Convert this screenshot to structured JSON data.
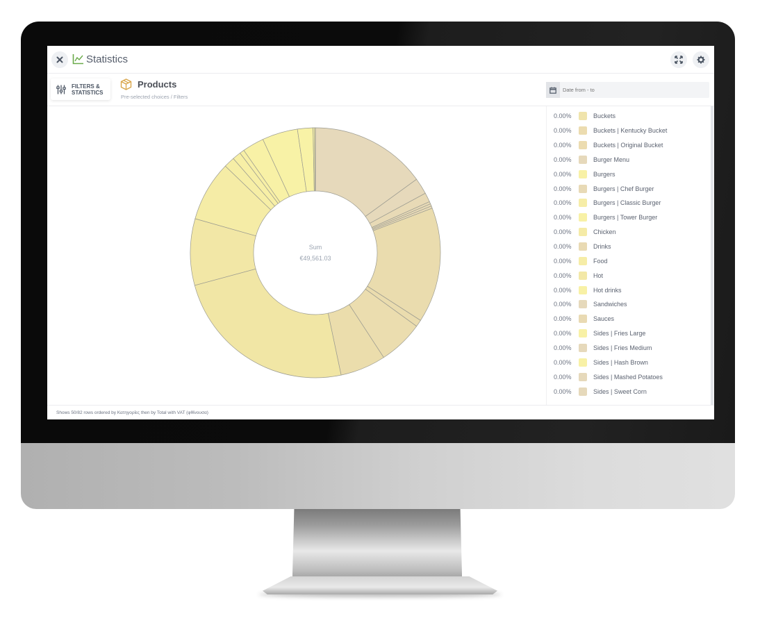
{
  "window": {
    "title": "Statistics",
    "close_icon": "close-icon",
    "title_icon": "line-chart-icon",
    "expand_icon": "expand-icon",
    "settings_icon": "gear-icon"
  },
  "toolbar": {
    "filters_label_line1": "FILTERS &",
    "filters_label_line2": "STATISTICS",
    "section_title": "Products",
    "section_subtitle": "Pre-selected choices / Filters",
    "date_placeholder": "Date from - to"
  },
  "footer": {
    "status_text": "Shows 50/82 rows ordered by Κατηγορίες then by Total with VAT (φθίνουσα)"
  },
  "colors": {
    "accent_green": "#6aaa4a",
    "box_gold": "#d9a54a",
    "slice_beige": "#e6d9bb",
    "slice_tan": "#ead9b0",
    "slice_khaki": "#ecdfad",
    "slice_yellow": "#f3e9a8",
    "slice_light_yellow": "#f8f1a6",
    "slice_border": "#9a9a90"
  },
  "chart_data": {
    "type": "pie",
    "variant": "donut",
    "title": "Products",
    "center_label": "Sum",
    "center_value": "€49,561.03",
    "total": 49561.03,
    "slices_percent_clockwise_from_top": [
      {
        "percent": 15.0,
        "color": "#e6d9bb"
      },
      {
        "percent": 2.1,
        "color": "#e6d9bb"
      },
      {
        "percent": 1.2,
        "color": "#e8dab6"
      },
      {
        "percent": 0.3,
        "color": "#e8dab6"
      },
      {
        "percent": 0.3,
        "color": "#e8dab6"
      },
      {
        "percent": 0.3,
        "color": "#e8dab6"
      },
      {
        "percent": 14.9,
        "color": "#eadcae"
      },
      {
        "percent": 0.9,
        "color": "#eadcae"
      },
      {
        "percent": 5.8,
        "color": "#ebddaf"
      },
      {
        "percent": 5.9,
        "color": "#ebddac"
      },
      {
        "percent": 24.1,
        "color": "#f1e6a5"
      },
      {
        "percent": 8.6,
        "color": "#f2e7a6"
      },
      {
        "percent": 7.8,
        "color": "#f5eca6"
      },
      {
        "percent": 1.4,
        "color": "#f6eea6"
      },
      {
        "percent": 1.1,
        "color": "#f7efa6"
      },
      {
        "percent": 0.6,
        "color": "#f7efa6"
      },
      {
        "percent": 2.8,
        "color": "#f8f1a6"
      },
      {
        "percent": 4.6,
        "color": "#f8f2a6"
      },
      {
        "percent": 2.0,
        "color": "#f8f2a6"
      },
      {
        "percent": 0.2,
        "color": "#f8f2a6"
      },
      {
        "percent": 0.1,
        "color": "#f8f2a6"
      }
    ],
    "legend_placement": "right",
    "legend": [
      {
        "pct": "0.00%",
        "label": "Buckets",
        "color": "#f0e4ac"
      },
      {
        "pct": "0.00%",
        "label": "Buckets | Kentucky Bucket",
        "color": "#ecdcb0"
      },
      {
        "pct": "0.00%",
        "label": "Buckets | Original Bucket",
        "color": "#ecdcb0"
      },
      {
        "pct": "0.00%",
        "label": "Burger Menu",
        "color": "#e6d9bb"
      },
      {
        "pct": "0.00%",
        "label": "Burgers",
        "color": "#f8f1a6"
      },
      {
        "pct": "0.00%",
        "label": "Burgers | Chef Burger",
        "color": "#e8dab6"
      },
      {
        "pct": "0.00%",
        "label": "Burgers | Classic Burger",
        "color": "#f6eda7"
      },
      {
        "pct": "0.00%",
        "label": "Burgers | Tower Burger",
        "color": "#f8f1a6"
      },
      {
        "pct": "0.00%",
        "label": "Chicken",
        "color": "#f5eba7"
      },
      {
        "pct": "0.00%",
        "label": "Drinks",
        "color": "#e9dab3"
      },
      {
        "pct": "0.00%",
        "label": "Food",
        "color": "#f6eda7"
      },
      {
        "pct": "0.00%",
        "label": "Hot",
        "color": "#f3e8a7"
      },
      {
        "pct": "0.00%",
        "label": "Hot drinks",
        "color": "#f8f1a6"
      },
      {
        "pct": "0.00%",
        "label": "Sandwiches",
        "color": "#e6d9bb"
      },
      {
        "pct": "0.00%",
        "label": "Sauces",
        "color": "#e9dab3"
      },
      {
        "pct": "0.00%",
        "label": "Sides | Fries Large",
        "color": "#f8f1a6"
      },
      {
        "pct": "0.00%",
        "label": "Sides | Fries Medium",
        "color": "#e6d9bb"
      },
      {
        "pct": "0.00%",
        "label": "Sides | Hash Brown",
        "color": "#f8f1a6"
      },
      {
        "pct": "0.00%",
        "label": "Sides | Mashed Potatoes",
        "color": "#e6d9bb"
      },
      {
        "pct": "0.00%",
        "label": "Sides | Sweet Corn",
        "color": "#e6d9bb"
      }
    ]
  }
}
